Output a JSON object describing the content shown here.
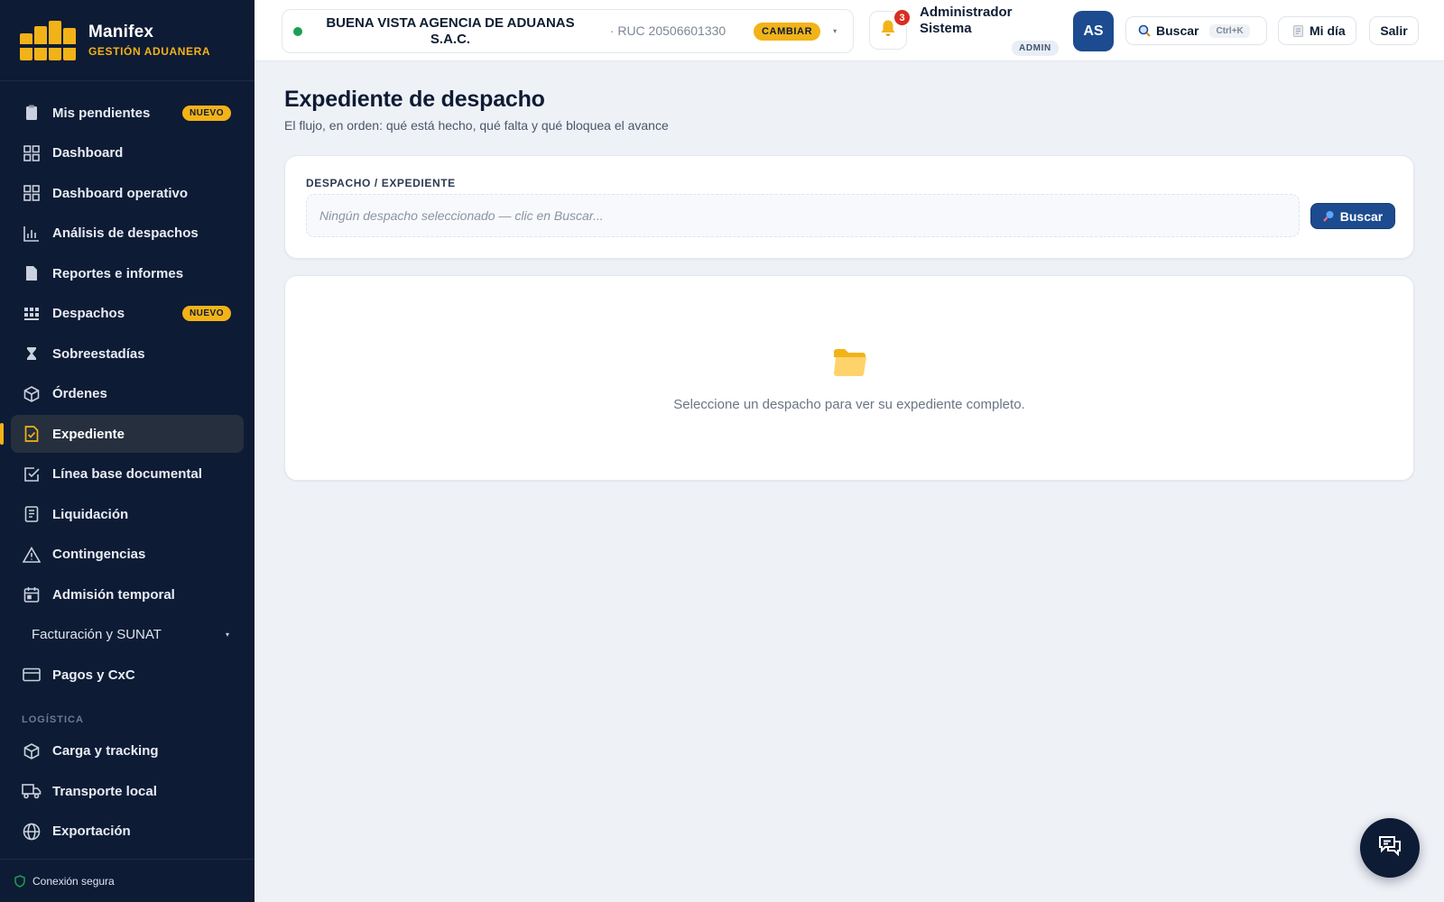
{
  "brand": {
    "name": "Manifex",
    "subtitle": "GESTIÓN ADUANERA"
  },
  "sidebar": {
    "items": [
      {
        "label": "Mis pendientes",
        "badge": "NUEVO",
        "icon": "clipboard-icon"
      },
      {
        "label": "Dashboard",
        "icon": "grid-icon"
      },
      {
        "label": "Dashboard operativo",
        "icon": "grid-icon"
      },
      {
        "label": "Análisis de despachos",
        "icon": "bar-chart-icon"
      },
      {
        "label": "Reportes e informes",
        "icon": "document-icon"
      },
      {
        "label": "Despachos",
        "badge": "NUEVO",
        "icon": "containers-icon"
      },
      {
        "label": "Sobreestadías",
        "icon": "hourglass-icon"
      },
      {
        "label": "Órdenes",
        "icon": "box-icon"
      },
      {
        "label": "Expediente",
        "icon": "file-check-icon",
        "active": true
      },
      {
        "label": "Línea base documental",
        "icon": "checkbox-icon"
      },
      {
        "label": "Liquidación",
        "icon": "receipt-icon"
      },
      {
        "label": "Contingencias",
        "icon": "warning-icon"
      },
      {
        "label": "Admisión temporal",
        "icon": "calendar-icon"
      }
    ],
    "group": {
      "label": "Facturación y SUNAT",
      "caret": "▾"
    },
    "items2": [
      {
        "label": "Pagos y CxC",
        "icon": "credit-card-icon"
      }
    ],
    "section_logistica": "LOGÍSTICA",
    "logistica_items": [
      {
        "label": "Carga y tracking",
        "icon": "box-icon"
      },
      {
        "label": "Transporte local",
        "icon": "truck-icon"
      },
      {
        "label": "Exportación",
        "icon": "globe-icon"
      }
    ],
    "footer": "Conexión segura"
  },
  "topbar": {
    "agency_name": "BUENA VISTA AGENCIA DE ADUANAS S.A.C.",
    "ruc": "· RUC 20506601330",
    "change_label": "CAMBIAR",
    "notifications_count": "3",
    "user_name": "Administrador Sistema",
    "user_role": "ADMIN",
    "avatar_initials": "AS",
    "search_label": "Buscar",
    "search_shortcut": "Ctrl+K",
    "myday_label": "Mi día",
    "logout_label": "Salir"
  },
  "main": {
    "title": "Expediente de despacho",
    "subtitle": "El flujo, en orden: qué está hecho, qué falta y qué bloquea el avance",
    "field_label": "DESPACHO / EXPEDIENTE",
    "field_placeholder": "Ningún despacho seleccionado — clic en Buscar...",
    "search_button": "Buscar",
    "empty_text": "Seleccione un despacho para ver su expediente completo."
  },
  "colors": {
    "sidebar_bg": "#0e1b34",
    "accent": "#f2b319",
    "primary": "#1c4b8f",
    "page_bg": "#eef1f6"
  }
}
